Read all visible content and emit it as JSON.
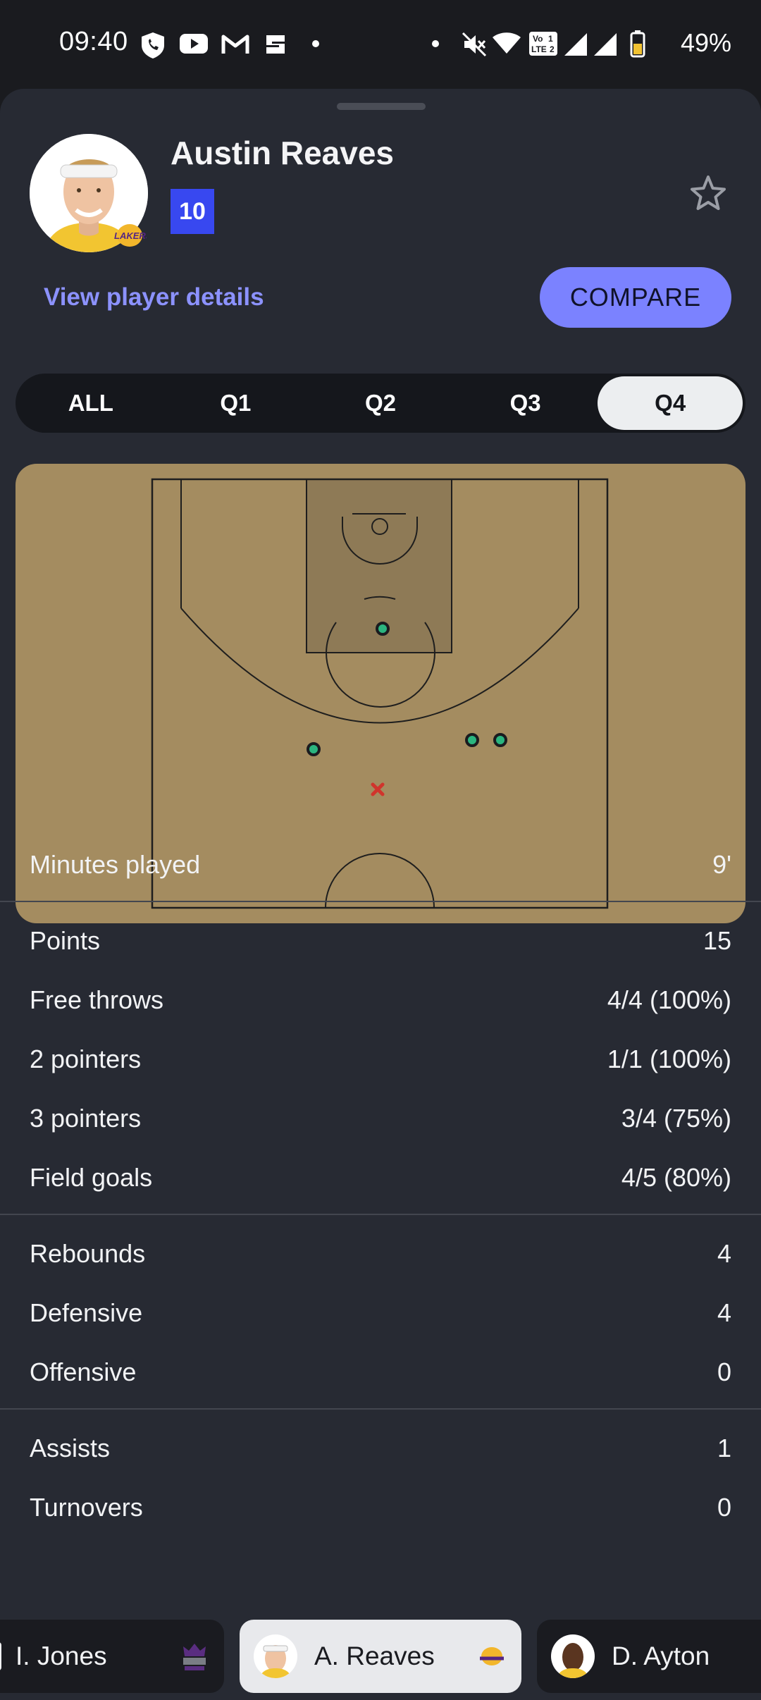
{
  "status_bar": {
    "time": "09:40",
    "battery": "49%",
    "icons": [
      "shield-phone-icon",
      "youtube-icon",
      "gmail-icon",
      "app-s-icon",
      "dot-icon",
      "dot-icon",
      "mute-icon",
      "wifi-icon",
      "volte-icon",
      "signal-icon",
      "signal-icon",
      "battery-icon"
    ]
  },
  "player": {
    "name": "Austin Reaves",
    "number": "10",
    "details_link": "View player details",
    "compare_label": "COMPARE",
    "team_logo_text": "LAKERS"
  },
  "tabs": [
    {
      "label": "ALL",
      "active": false
    },
    {
      "label": "Q1",
      "active": false
    },
    {
      "label": "Q2",
      "active": false
    },
    {
      "label": "Q3",
      "active": false
    },
    {
      "label": "Q4",
      "active": true
    }
  ],
  "court": {
    "court_color": "#a48c60",
    "made_color": "#2bb57f",
    "missed_color": "#d0342c",
    "shots": [
      {
        "result": "made"
      },
      {
        "result": "made"
      },
      {
        "result": "made"
      },
      {
        "result": "made"
      },
      {
        "result": "missed"
      }
    ]
  },
  "stats": {
    "minutes": {
      "label": "Minutes played",
      "value": "9'"
    },
    "scoring": [
      {
        "label": "Points",
        "value": "15"
      },
      {
        "label": "Free throws",
        "value": "4/4 (100%)"
      },
      {
        "label": "2 pointers",
        "value": "1/1 (100%)"
      },
      {
        "label": "3 pointers",
        "value": "3/4 (75%)"
      },
      {
        "label": "Field goals",
        "value": "4/5 (80%)"
      }
    ],
    "rebounds": [
      {
        "label": "Rebounds",
        "value": "4"
      },
      {
        "label": "Defensive",
        "value": "4"
      },
      {
        "label": "Offensive",
        "value": "0"
      }
    ],
    "other": [
      {
        "label": "Assists",
        "value": "1"
      },
      {
        "label": "Turnovers",
        "value": "0"
      }
    ]
  },
  "carousel": [
    {
      "name": "I. Jones",
      "team": "kings-logo-icon"
    },
    {
      "name": "A. Reaves",
      "team": "lakers-logo-icon",
      "selected": true
    },
    {
      "name": "D. Ayton"
    }
  ]
}
